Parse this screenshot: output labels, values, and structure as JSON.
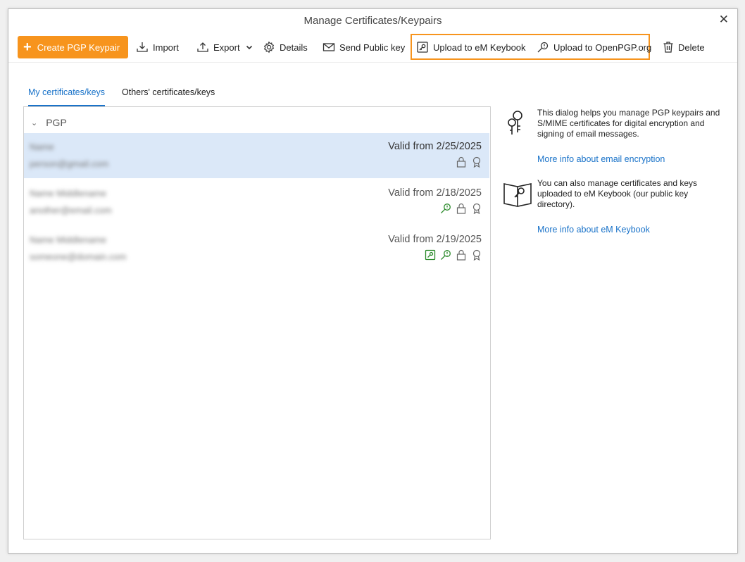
{
  "window": {
    "title": "Manage Certificates/Keypairs"
  },
  "toolbar": {
    "create": "Create PGP Keypair",
    "import": "Import",
    "export": "Export",
    "details": "Details",
    "send_public_key": "Send Public key",
    "upload_em_keybook": "Upload to eM Keybook",
    "upload_openpgp": "Upload to OpenPGP.org",
    "delete": "Delete"
  },
  "tabs": [
    {
      "label": "My certificates/keys",
      "active": true
    },
    {
      "label": "Others' certificates/keys",
      "active": false
    }
  ],
  "list": {
    "group": "PGP",
    "rows": [
      {
        "name": "Name",
        "email": "person@gmail.com",
        "valid": "Valid from 2/25/2025",
        "selected": true
      },
      {
        "name": "Name Middlename",
        "email": "another@email.com",
        "valid": "Valid from 2/18/2025",
        "selected": false
      },
      {
        "name": "Name Middlename",
        "email": "someone@domain.com",
        "valid": "Valid from 2/19/2025",
        "selected": false
      }
    ]
  },
  "side": {
    "info1": "This dialog helps you manage PGP keypairs and S/MIME certificates for digital encryption and signing of email messages.",
    "link1": "More info about email encryption",
    "info2": "You can also manage certificates and keys uploaded to eM Keybook (our public key directory).",
    "link2": "More info about eM Keybook"
  },
  "colors": {
    "accent": "#f7941d",
    "link": "#1a73c9",
    "selected_row": "#dbe8f8",
    "verified_icon": "#2a8a2a"
  }
}
